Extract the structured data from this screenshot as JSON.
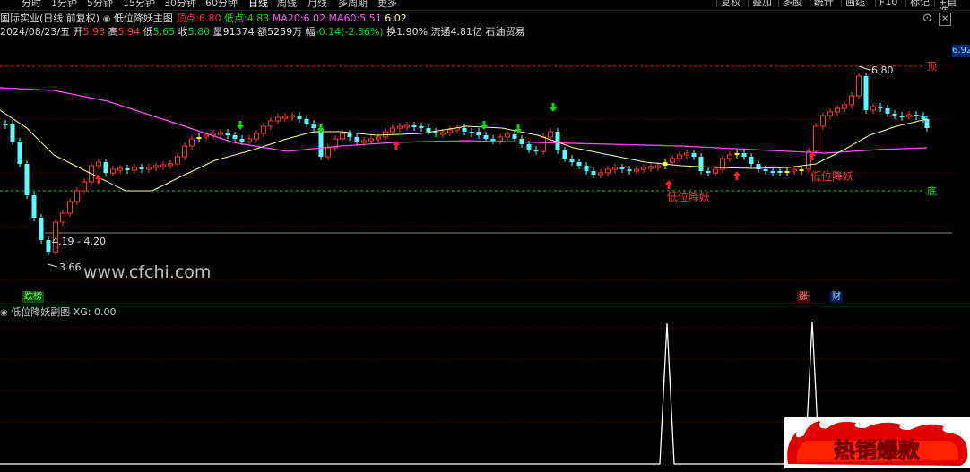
{
  "menu": {
    "items": [
      "分时",
      "1分钟",
      "5分钟",
      "15分钟",
      "30分钟",
      "60分钟",
      "日线",
      "周线",
      "月线",
      "多周期",
      "更多"
    ],
    "active_index": 6,
    "right_buttons": [
      "复权",
      "叠加",
      "多股",
      "统计",
      "画线",
      "F10",
      "标记",
      "+自选"
    ]
  },
  "header": {
    "stock_name": "国际实业",
    "period_label": "(日线 前复权)",
    "indicator_name": "低位降妖主图",
    "top_label": "顶点:",
    "top_value": "6.80",
    "low_label": "低点:",
    "low_value": "4.83",
    "ma20_label": "MA20:",
    "ma20_value": "6.02",
    "ma60_label": "MA60:",
    "ma60_value": "5.51",
    "extra_value": "6.02"
  },
  "quote": {
    "date": "2024/08/23/五",
    "open_label": "开",
    "open": "5.93",
    "high_label": "高",
    "high": "5.94",
    "low_label": "低",
    "low": "5.65",
    "close_label": "收",
    "close": "5.80",
    "volume_label": "量",
    "volume": "91374",
    "amount_label": "额",
    "amount": "5259万",
    "change_label": "幅",
    "change": "-0.14(-2.36%)",
    "turnover_label": "换",
    "turnover": "1.90%",
    "float_label": "流通",
    "float": "4.81亿",
    "industry": "石油贸易"
  },
  "right_price": "6.92",
  "chart_labels": {
    "top_marker": "顶",
    "bottom_marker": "底",
    "high_annotation": "6.80",
    "low_annotation": "3.66",
    "range_annotation": "4.19 - 4.20",
    "signal_text_1": "低位降妖",
    "signal_text_2": "低位降妖"
  },
  "badges": {
    "left": [
      "跌",
      "榜"
    ],
    "right": [
      "涨",
      "财"
    ]
  },
  "sub_panel": {
    "title": "低位降妖副图",
    "xg_label": "XG:",
    "xg_value": "0.00"
  },
  "watermark": "www.cfchi.com",
  "promo_text": "热销爆款",
  "colors": {
    "up": "#ff3232",
    "down": "#54ffff",
    "ma20": "#ffff9c",
    "ma60": "#ff54ff",
    "yellow_bar": "#ffff00",
    "signal_up": "#ff2020",
    "signal_down": "#00e000",
    "dashed_top": "#c02020",
    "dashed_bottom": "#20c020"
  }
}
